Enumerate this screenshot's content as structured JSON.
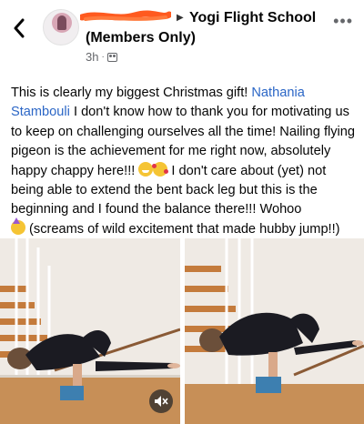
{
  "header": {
    "back_icon": "back-arrow-icon",
    "group_name_line1": "Yogi Flight School",
    "group_name_line2": "(Members Only)",
    "timestamp": "3h",
    "separator": "·",
    "privacy_icon": "group-icon",
    "more_icon": "more-options-icon",
    "more_label": "•••",
    "arrow": "▶"
  },
  "post": {
    "text_1": "This is clearly my biggest Christmas gift! ",
    "mention": "Nathania Stambouli",
    "text_2": " I don't know how to thank you for motivating us to keep on challenging  ourselves all the time! Nailing flying pigeon is the achievement for me right now, absolutely happy chappy here!!! ",
    "text_3": " I don't care about (yet) not being able to extend the bent back leg but this is the beginning and I found the balance there!!! Wohoo ",
    "text_4": " (screams of wild excitement that made hubby jump!!)",
    "emojis": [
      "grinning-face-icon",
      "smiling-face-with-hearts-icon",
      "partying-face-icon"
    ]
  },
  "media": {
    "left": "yoga-flying-pigeon-photo-1",
    "right": "yoga-flying-pigeon-photo-2",
    "mute_icon": "speaker-muted-icon"
  },
  "colors": {
    "text": "#050505",
    "mention": "#2b66c6",
    "meta": "#65676b",
    "scribble": "#ff5a1f"
  }
}
